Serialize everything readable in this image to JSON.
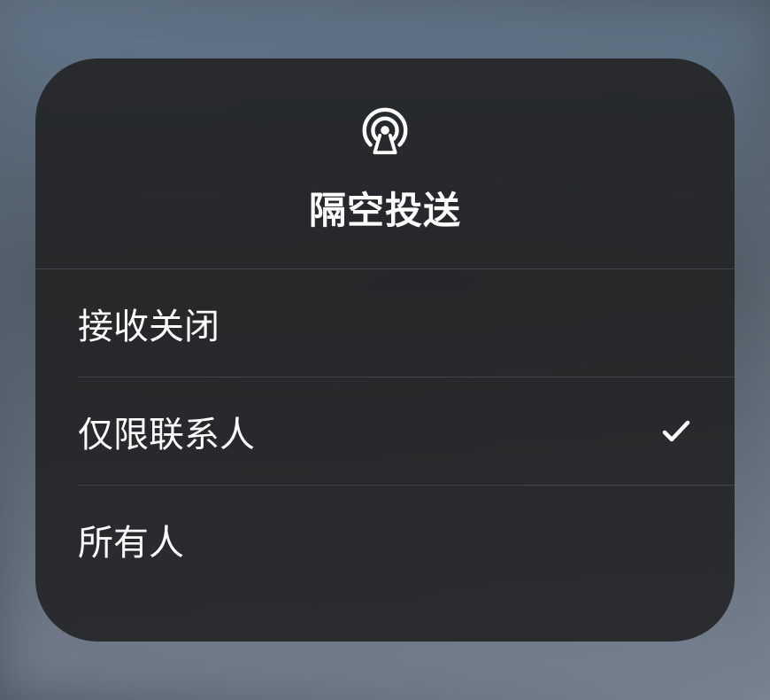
{
  "header": {
    "title": "隔空投送",
    "icon": "airdrop-icon"
  },
  "options": [
    {
      "label": "接收关闭",
      "selected": false
    },
    {
      "label": "仅限联系人",
      "selected": true
    },
    {
      "label": "所有人",
      "selected": false
    }
  ]
}
